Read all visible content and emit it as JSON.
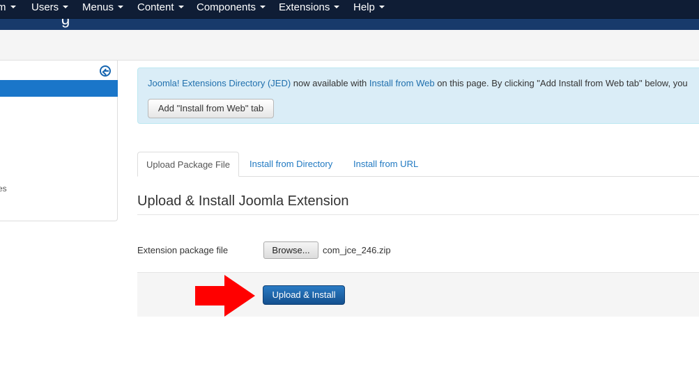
{
  "topnav": {
    "items": [
      {
        "label": "m"
      },
      {
        "label": "Users"
      },
      {
        "label": "Menus"
      },
      {
        "label": "Content"
      },
      {
        "label": "Components"
      },
      {
        "label": "Extensions"
      },
      {
        "label": "Help"
      }
    ]
  },
  "header": {
    "title_fragment": "g"
  },
  "sidebar": {
    "partial_item": "es"
  },
  "jed_alert": {
    "link_jed": "Joomla! Extensions Directory (JED)",
    "text_mid": " now available with ",
    "link_install_web": "Install from Web",
    "text_end": " on this page.  By clicking \"Add Install from Web tab\" below, you",
    "button_label": "Add \"Install from Web\" tab"
  },
  "tabs": [
    {
      "label": "Upload Package File",
      "active": true
    },
    {
      "label": "Install from Directory",
      "active": false
    },
    {
      "label": "Install from URL",
      "active": false
    }
  ],
  "main": {
    "heading": "Upload & Install Joomla Extension",
    "file_label": "Extension package file",
    "browse_label": "Browse...",
    "file_name": "com_jce_246.zip",
    "upload_button": "Upload & Install"
  },
  "colors": {
    "nav_bg": "#0f1d35",
    "header_bg": "#183a6b",
    "sidebar_active": "#1a76c9",
    "alert_bg": "#daedf7",
    "link": "#1f78c1",
    "primary_button": "#1a63a8",
    "annotation_arrow": "#ff0000"
  },
  "icons": {
    "sidebar_toggle": "arrow-left-circle-icon",
    "annotation": "red-arrow-right-icon"
  }
}
